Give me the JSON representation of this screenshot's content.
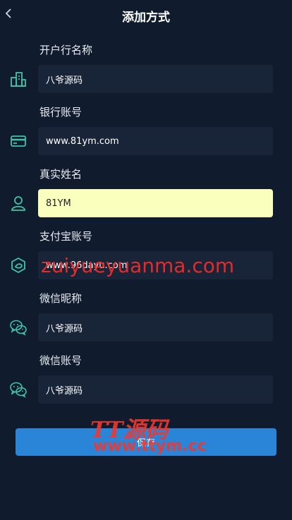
{
  "header": {
    "title": "添加方式"
  },
  "fields": [
    {
      "label": "开户行名称",
      "value": "八爷源码",
      "icon": "bank-building-icon"
    },
    {
      "label": "银行账号",
      "value": "www.81ym.com",
      "icon": "bank-card-icon"
    },
    {
      "label": "真实姓名",
      "value": "81YM",
      "icon": "user-icon"
    },
    {
      "label": "支付宝账号",
      "value": "www.96dayu.com",
      "icon": "alipay-icon"
    },
    {
      "label": "微信昵称",
      "value": "八爷源码",
      "icon": "wechat-icon"
    },
    {
      "label": "微信账号",
      "value": "八爷源码",
      "icon": "wechat-icon"
    }
  ],
  "save_label": "保存",
  "watermarks": {
    "line1": "zuiyueyuanma.com",
    "line2": "TT源码",
    "line3": "www.ttym.cc"
  },
  "colors": {
    "background": "#101c2d",
    "input_background": "#182437",
    "autofill_background": "#faffbd",
    "icon_accent": "#3fc4a8",
    "button": "#2a85d9",
    "watermark": "#ef2b2b"
  }
}
